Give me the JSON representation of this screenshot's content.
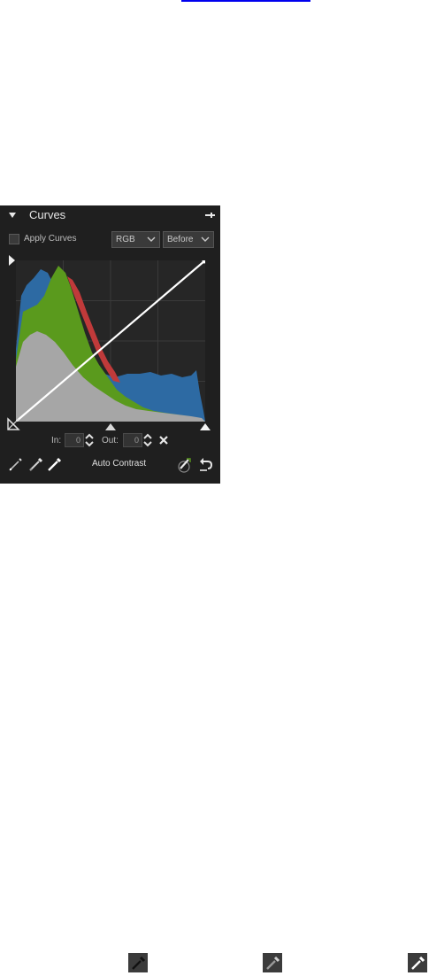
{
  "page": {
    "background": "#ffffff",
    "link_color": "#0000ee"
  },
  "panel": {
    "title": "Curves",
    "apply_label": "Apply Curves",
    "channel_select": "RGB",
    "view_select": "Before",
    "in_label": "In:",
    "in_value": "0",
    "out_label": "Out:",
    "out_value": "0",
    "auto_contrast": "Auto Contrast",
    "icons": {
      "collapse": "triangle-down-icon",
      "pin": "pin-icon",
      "play": "play-arrow-icon",
      "reset": "close-icon",
      "black_point": "eyedropper-black-icon",
      "gray_point": "eyedropper-gray-icon",
      "white_point": "eyedropper-white-icon",
      "auto_adjust": "magic-brush-icon",
      "undo": "undo-icon"
    },
    "colors": {
      "panel_bg": "#1f1f1f",
      "graph_bg": "#262626",
      "hist_gray": "#a6a6a6",
      "hist_blue": "#2d6aa3",
      "hist_green": "#5a9a1d",
      "hist_red": "#c03a3a",
      "curve": "#ffffff"
    }
  },
  "bottom_icons": [
    "eyedropper-black-icon",
    "eyedropper-gray-icon",
    "eyedropper-white-icon"
  ]
}
